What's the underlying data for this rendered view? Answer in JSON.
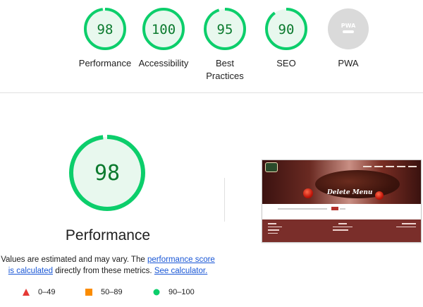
{
  "categories": [
    {
      "score": "98",
      "label": "Performance",
      "fraction": 0.98
    },
    {
      "score": "100",
      "label": "Accessibility",
      "fraction": 1.0
    },
    {
      "score": "95",
      "label": "Best Practices",
      "fraction": 0.95
    },
    {
      "score": "90",
      "label": "SEO",
      "fraction": 0.9
    },
    {
      "score": "",
      "label": "PWA",
      "badge": "PWA"
    }
  ],
  "main": {
    "score": "98",
    "fraction": 0.98,
    "title": "Performance",
    "desc_prefix": "Values are estimated and may vary. The ",
    "desc_link1": "performance score is calculated",
    "desc_middle": " directly from these metrics. ",
    "desc_link2": "See calculator."
  },
  "legend": [
    {
      "range": "0–49",
      "shape": "triangle",
      "color": "#e53935"
    },
    {
      "range": "50–89",
      "shape": "square",
      "color": "#fb8c00"
    },
    {
      "range": "90–100",
      "shape": "circle",
      "color": "#0cce6b"
    }
  ],
  "screenshot": {
    "hero_title": "Delete Menu"
  },
  "colors": {
    "pass": "#0cce6b",
    "pass_fill": "#e8f8ee",
    "pass_text": "#0b7a2e",
    "pwa_gray": "#dadada"
  }
}
